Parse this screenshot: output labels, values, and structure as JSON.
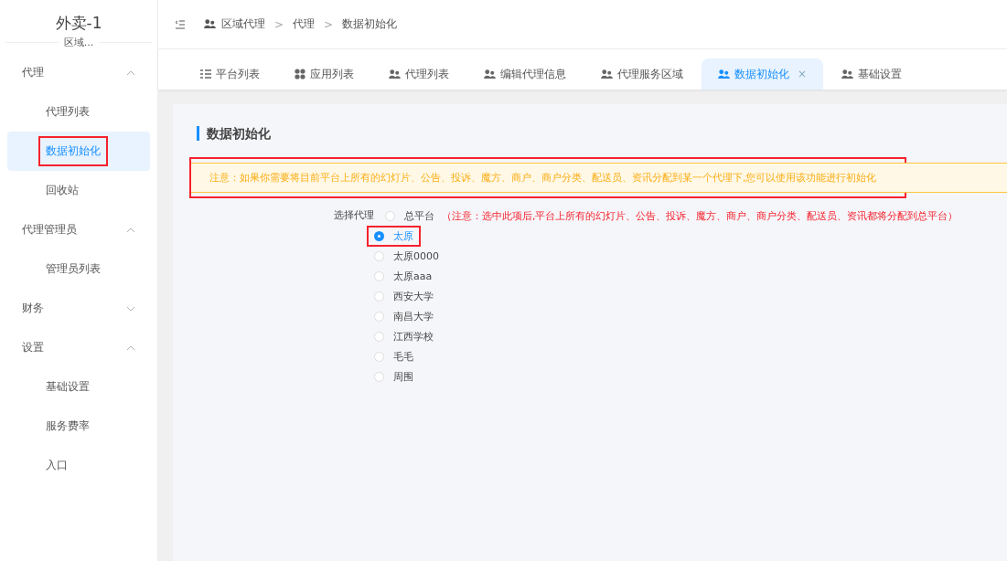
{
  "sidebar": {
    "title": "外卖-1",
    "subtitle": "区域...",
    "groups": [
      {
        "label": "代理",
        "expanded": true,
        "items": [
          {
            "label": "代理列表",
            "selected": false,
            "highlighted": false
          },
          {
            "label": "数据初始化",
            "selected": true,
            "highlighted": true
          },
          {
            "label": "回收站",
            "selected": false,
            "highlighted": false
          }
        ]
      },
      {
        "label": "代理管理员",
        "expanded": true,
        "items": [
          {
            "label": "管理员列表",
            "selected": false,
            "highlighted": false
          }
        ]
      },
      {
        "label": "财务",
        "expanded": false
      },
      {
        "label": "设置",
        "expanded": true,
        "items": [
          {
            "label": "基础设置",
            "selected": false,
            "highlighted": false
          },
          {
            "label": "服务费率",
            "selected": false,
            "highlighted": false
          },
          {
            "label": "入口",
            "selected": false,
            "highlighted": false
          }
        ]
      }
    ]
  },
  "breadcrumb": [
    "区域代理",
    "代理",
    "数据初始化"
  ],
  "breadcrumb_separator": ">",
  "tabs": [
    {
      "label": "平台列表",
      "kind": "list",
      "selected": false
    },
    {
      "label": "应用列表",
      "kind": "apps",
      "selected": false
    },
    {
      "label": "代理列表",
      "kind": "users",
      "selected": false
    },
    {
      "label": "编辑代理信息",
      "kind": "users",
      "selected": false
    },
    {
      "label": "代理服务区域",
      "kind": "users",
      "selected": false
    },
    {
      "label": "数据初始化",
      "kind": "users",
      "selected": true,
      "close": "×"
    },
    {
      "label": "基础设置",
      "kind": "users",
      "selected": false
    }
  ],
  "page_title": "数据初始化",
  "alert": {
    "text": "注意：如果你需要将目前平台上所有的幻灯片、公告、投诉、魔方、商户、商户分类、配送员、资讯分配到某一个代理下,您可以使用该功能进行初始化",
    "highlighted": true
  },
  "form": {
    "label": "选择代理",
    "note": "（注意：选中此项后,平台上所有的幻灯片、公告、投诉、魔方、商户、商户分类、配送员、资讯都将分配到总平台）",
    "options": [
      {
        "label": "总平台",
        "selected": false,
        "highlighted": false
      },
      {
        "label": "太原",
        "selected": true,
        "highlighted": true
      },
      {
        "label": "太原0000",
        "selected": false,
        "highlighted": false
      },
      {
        "label": "太原aaa",
        "selected": false,
        "highlighted": false
      },
      {
        "label": "西安大学",
        "selected": false,
        "highlighted": false
      },
      {
        "label": "南昌大学",
        "selected": false,
        "highlighted": false
      },
      {
        "label": "江西学校",
        "selected": false,
        "highlighted": false
      },
      {
        "label": "毛毛",
        "selected": false,
        "highlighted": false
      },
      {
        "label": "周围",
        "selected": false,
        "highlighted": false
      }
    ]
  }
}
